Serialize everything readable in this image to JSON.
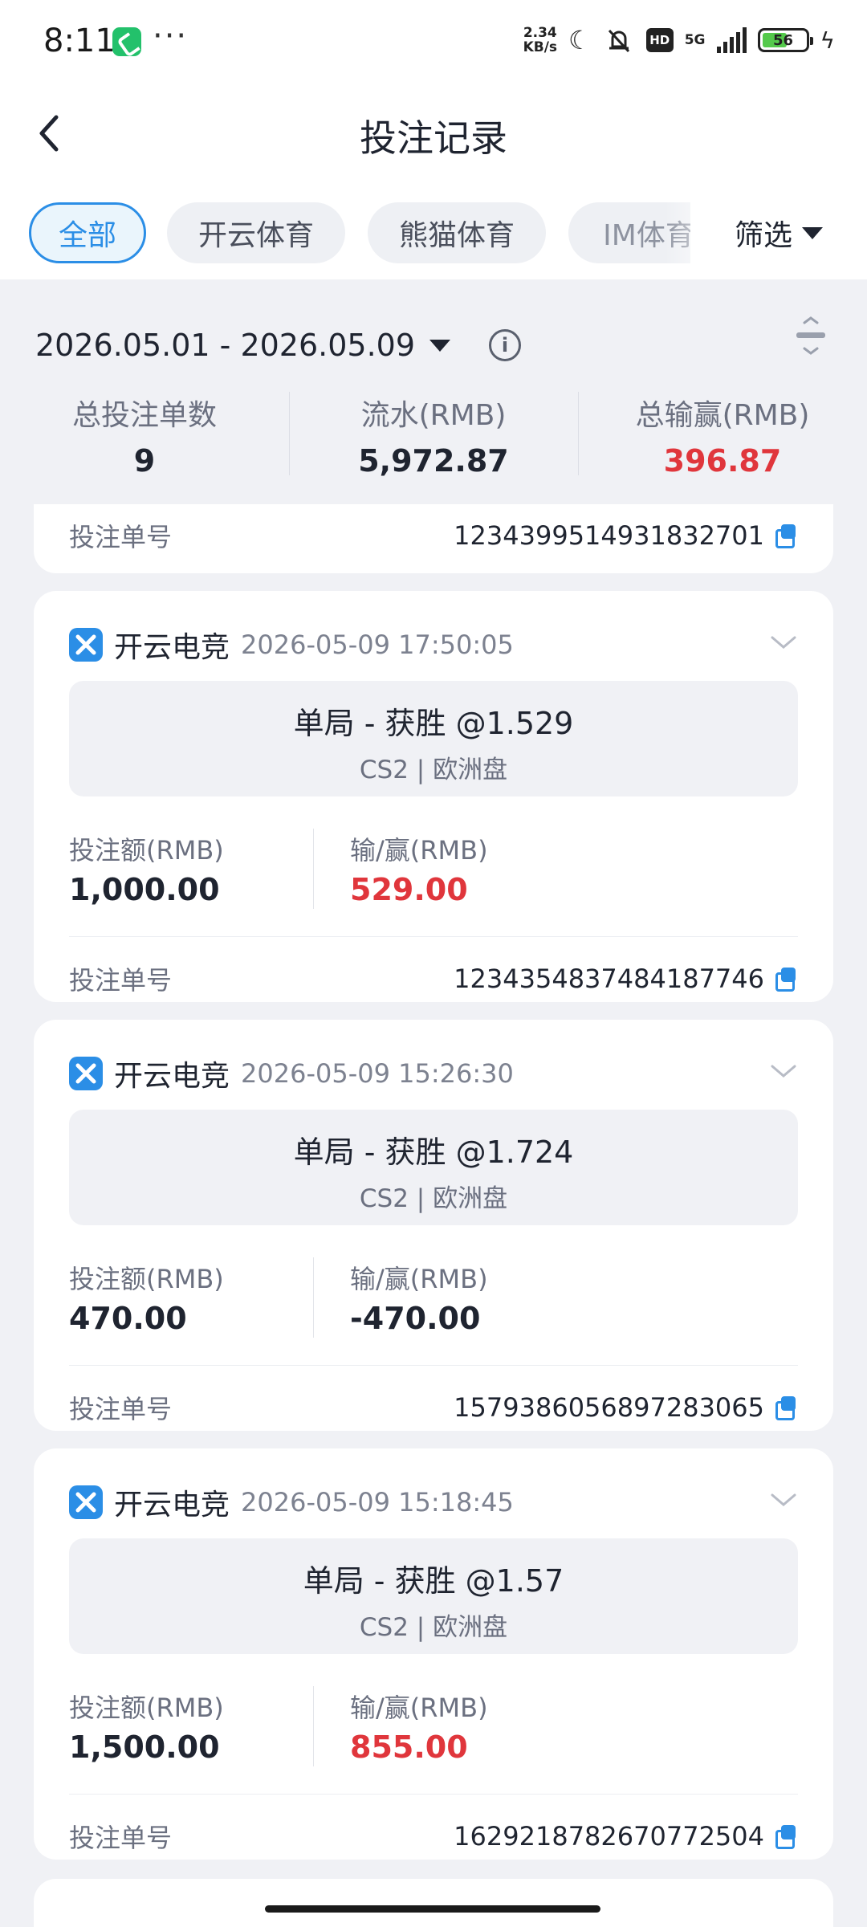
{
  "status_bar": {
    "time": "8:11",
    "dots": "···",
    "speed_top": "2.34",
    "speed_bottom": "KB/s",
    "network": "5G",
    "battery": "56"
  },
  "header": {
    "title": "投注记录"
  },
  "tabs": [
    {
      "label": "全部",
      "active": true
    },
    {
      "label": "开云体育"
    },
    {
      "label": "熊猫体育"
    },
    {
      "label": "IM体育"
    }
  ],
  "filter": {
    "label": "筛选"
  },
  "date_range": "2026.05.01 - 2026.05.09",
  "info_icon_glyph": "i",
  "summary": [
    {
      "label": "总投注单数",
      "value": "9"
    },
    {
      "label": "流水(RMB)",
      "value": "5,972.87"
    },
    {
      "label": "总输赢(RMB)",
      "value": "396.87",
      "color": "#e0363c"
    }
  ],
  "partial_card": {
    "order_label": "投注单号",
    "order_number": "1234399514931832701"
  },
  "labels": {
    "stake": "投注额(RMB)",
    "winloss": "输/赢(RMB)",
    "order": "投注单号"
  },
  "bets": [
    {
      "brand": "开云电竞",
      "time": "2026-05-09 17:50:05",
      "title": "单局 - 获胜 @1.529",
      "sub": "CS2 | 欧洲盘",
      "stake": "1,000.00",
      "winloss": "529.00",
      "win": true,
      "order_number": "1234354837484187746"
    },
    {
      "brand": "开云电竞",
      "time": "2026-05-09 15:26:30",
      "title": "单局 - 获胜 @1.724",
      "sub": "CS2 | 欧洲盘",
      "stake": "470.00",
      "winloss": "-470.00",
      "win": false,
      "order_number": "1579386056897283065"
    },
    {
      "brand": "开云电竞",
      "time": "2026-05-09 15:18:45",
      "title": "单局 - 获胜 @1.57",
      "sub": "CS2 | 欧洲盘",
      "stake": "1,500.00",
      "winloss": "855.00",
      "win": true,
      "order_number": "1629218782670772504"
    }
  ],
  "colors": {
    "accent": "#2b8ee6",
    "win_red": "#e0363c",
    "background": "#f0f1f5"
  }
}
